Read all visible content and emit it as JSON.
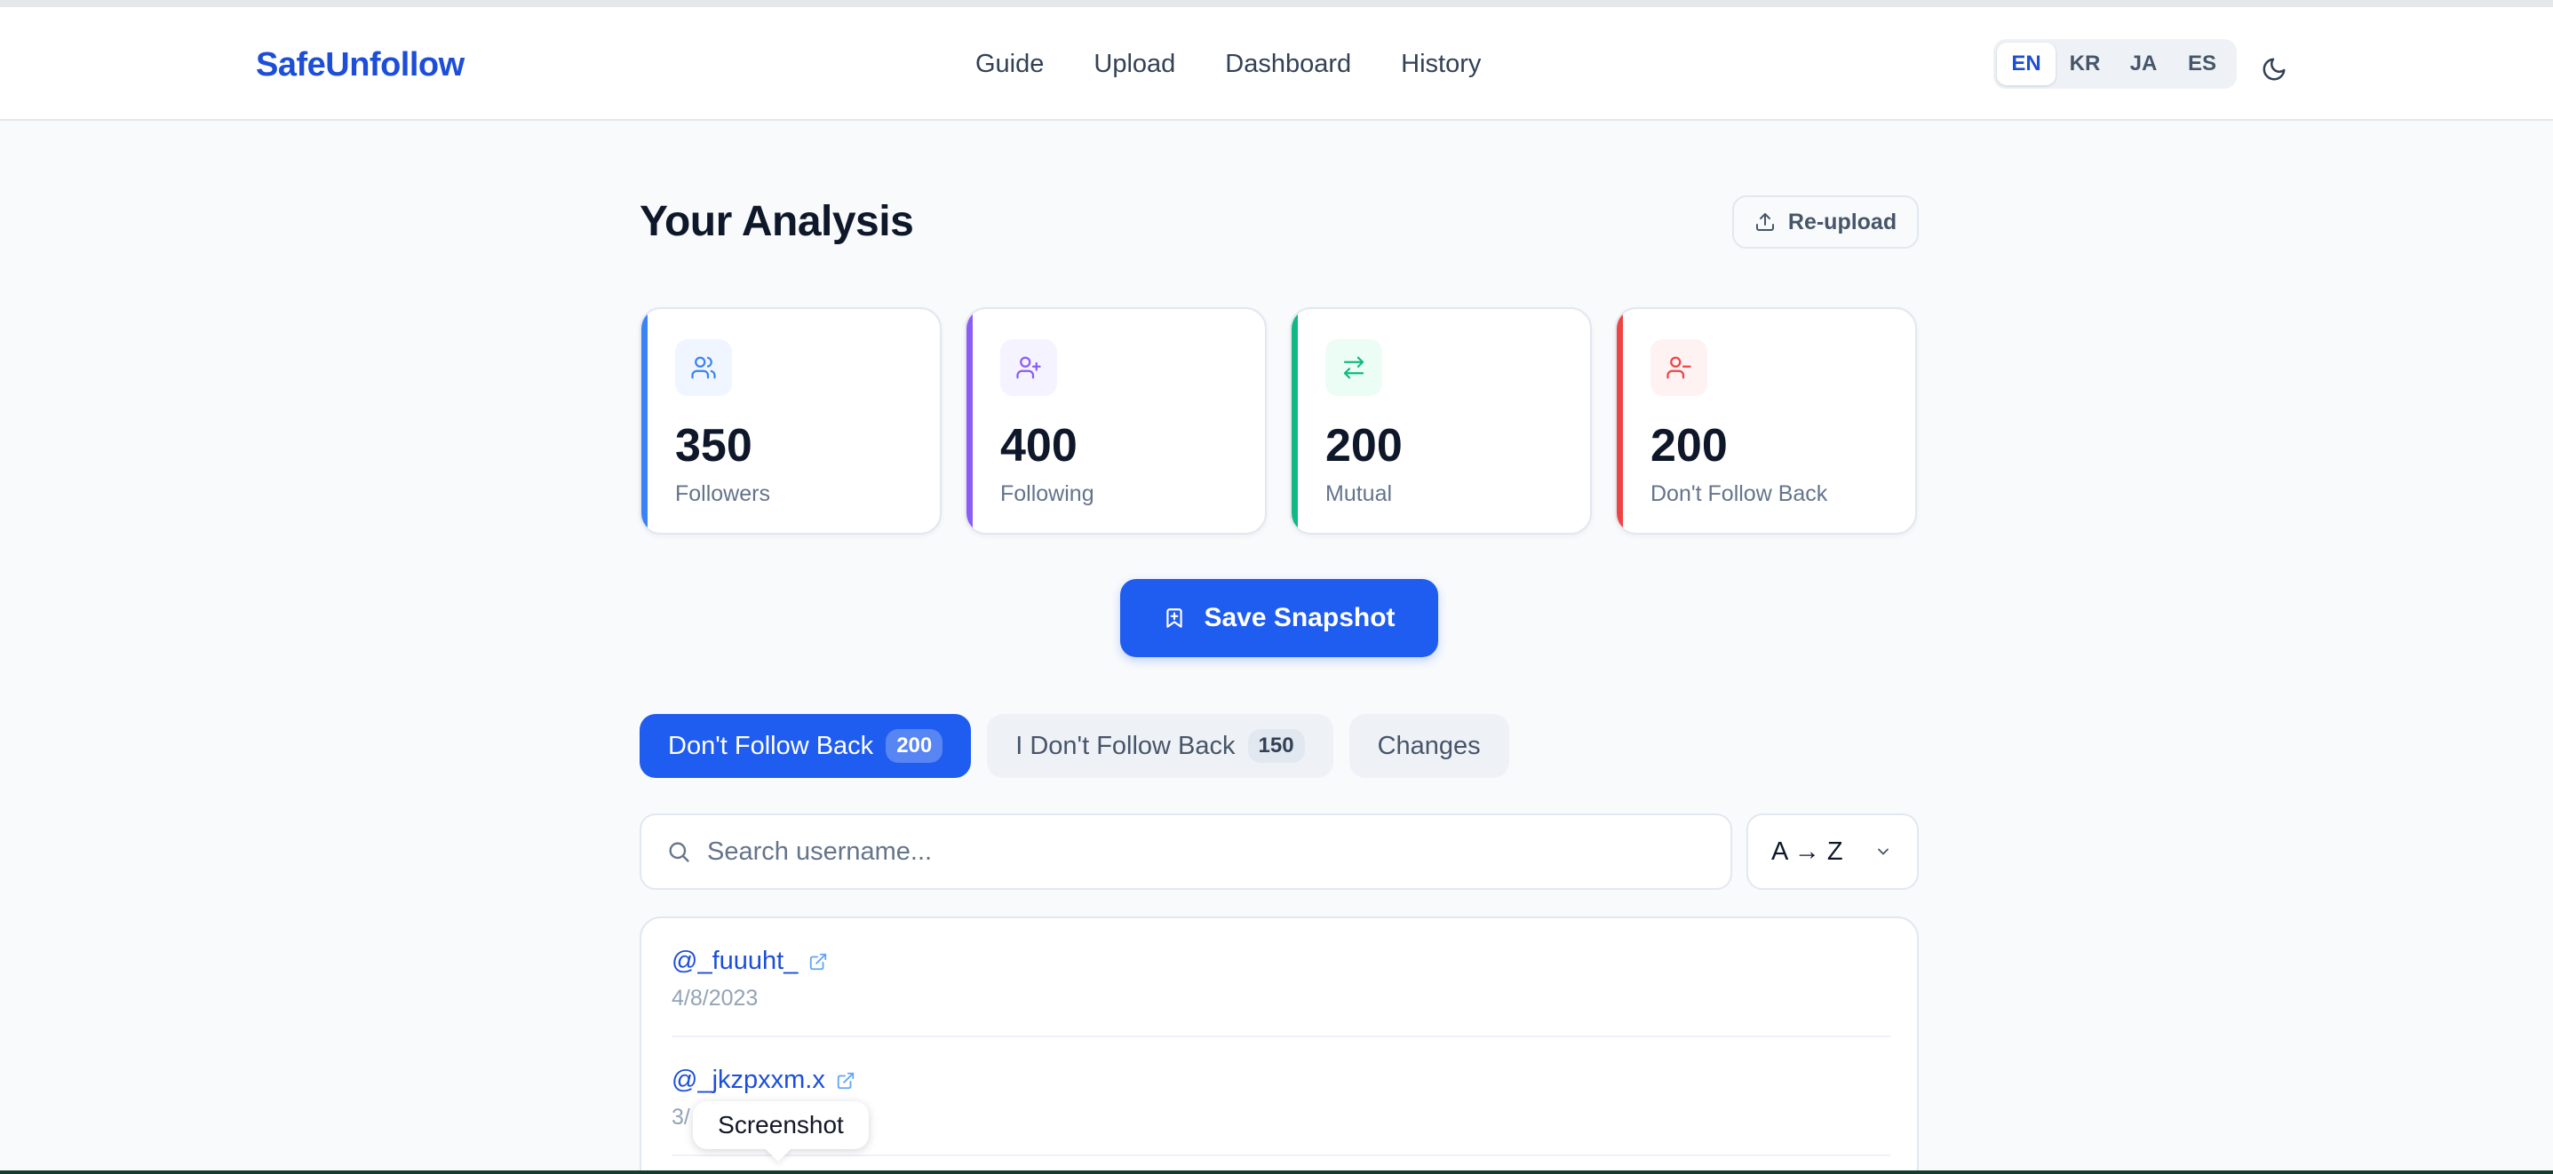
{
  "header": {
    "brand": "SafeUnfollow",
    "nav": [
      "Guide",
      "Upload",
      "Dashboard",
      "History"
    ],
    "languages": [
      "EN",
      "KR",
      "JA",
      "ES"
    ],
    "active_language": "EN"
  },
  "main": {
    "title": "Your Analysis",
    "reupload_label": "Re-upload",
    "stats": [
      {
        "value": "350",
        "label": "Followers",
        "color": "#3b82f6",
        "icon": "users-icon"
      },
      {
        "value": "400",
        "label": "Following",
        "color": "#8b5cf6",
        "icon": "user-plus-icon"
      },
      {
        "value": "200",
        "label": "Mutual",
        "color": "#10b981",
        "icon": "arrows-exchange-icon"
      },
      {
        "value": "200",
        "label": "Don't Follow Back",
        "color": "#ef4444",
        "icon": "user-minus-icon"
      }
    ],
    "save_label": "Save Snapshot",
    "tabs": [
      {
        "label": "Don't Follow Back",
        "count": "200",
        "active": true
      },
      {
        "label": "I Don't Follow Back",
        "count": "150",
        "active": false
      },
      {
        "label": "Changes",
        "count": null,
        "active": false
      }
    ],
    "search_placeholder": "Search username...",
    "sort_value": "A → Z",
    "users": [
      {
        "username": "@_fuuuht_",
        "date": "4/8/2023"
      },
      {
        "username": "@_jkzpxxm.x",
        "date": "3/"
      }
    ]
  },
  "tooltip": {
    "text": "Screenshot"
  },
  "colors": {
    "primary": "#1f5cf0",
    "brand": "#1d4ed8"
  }
}
